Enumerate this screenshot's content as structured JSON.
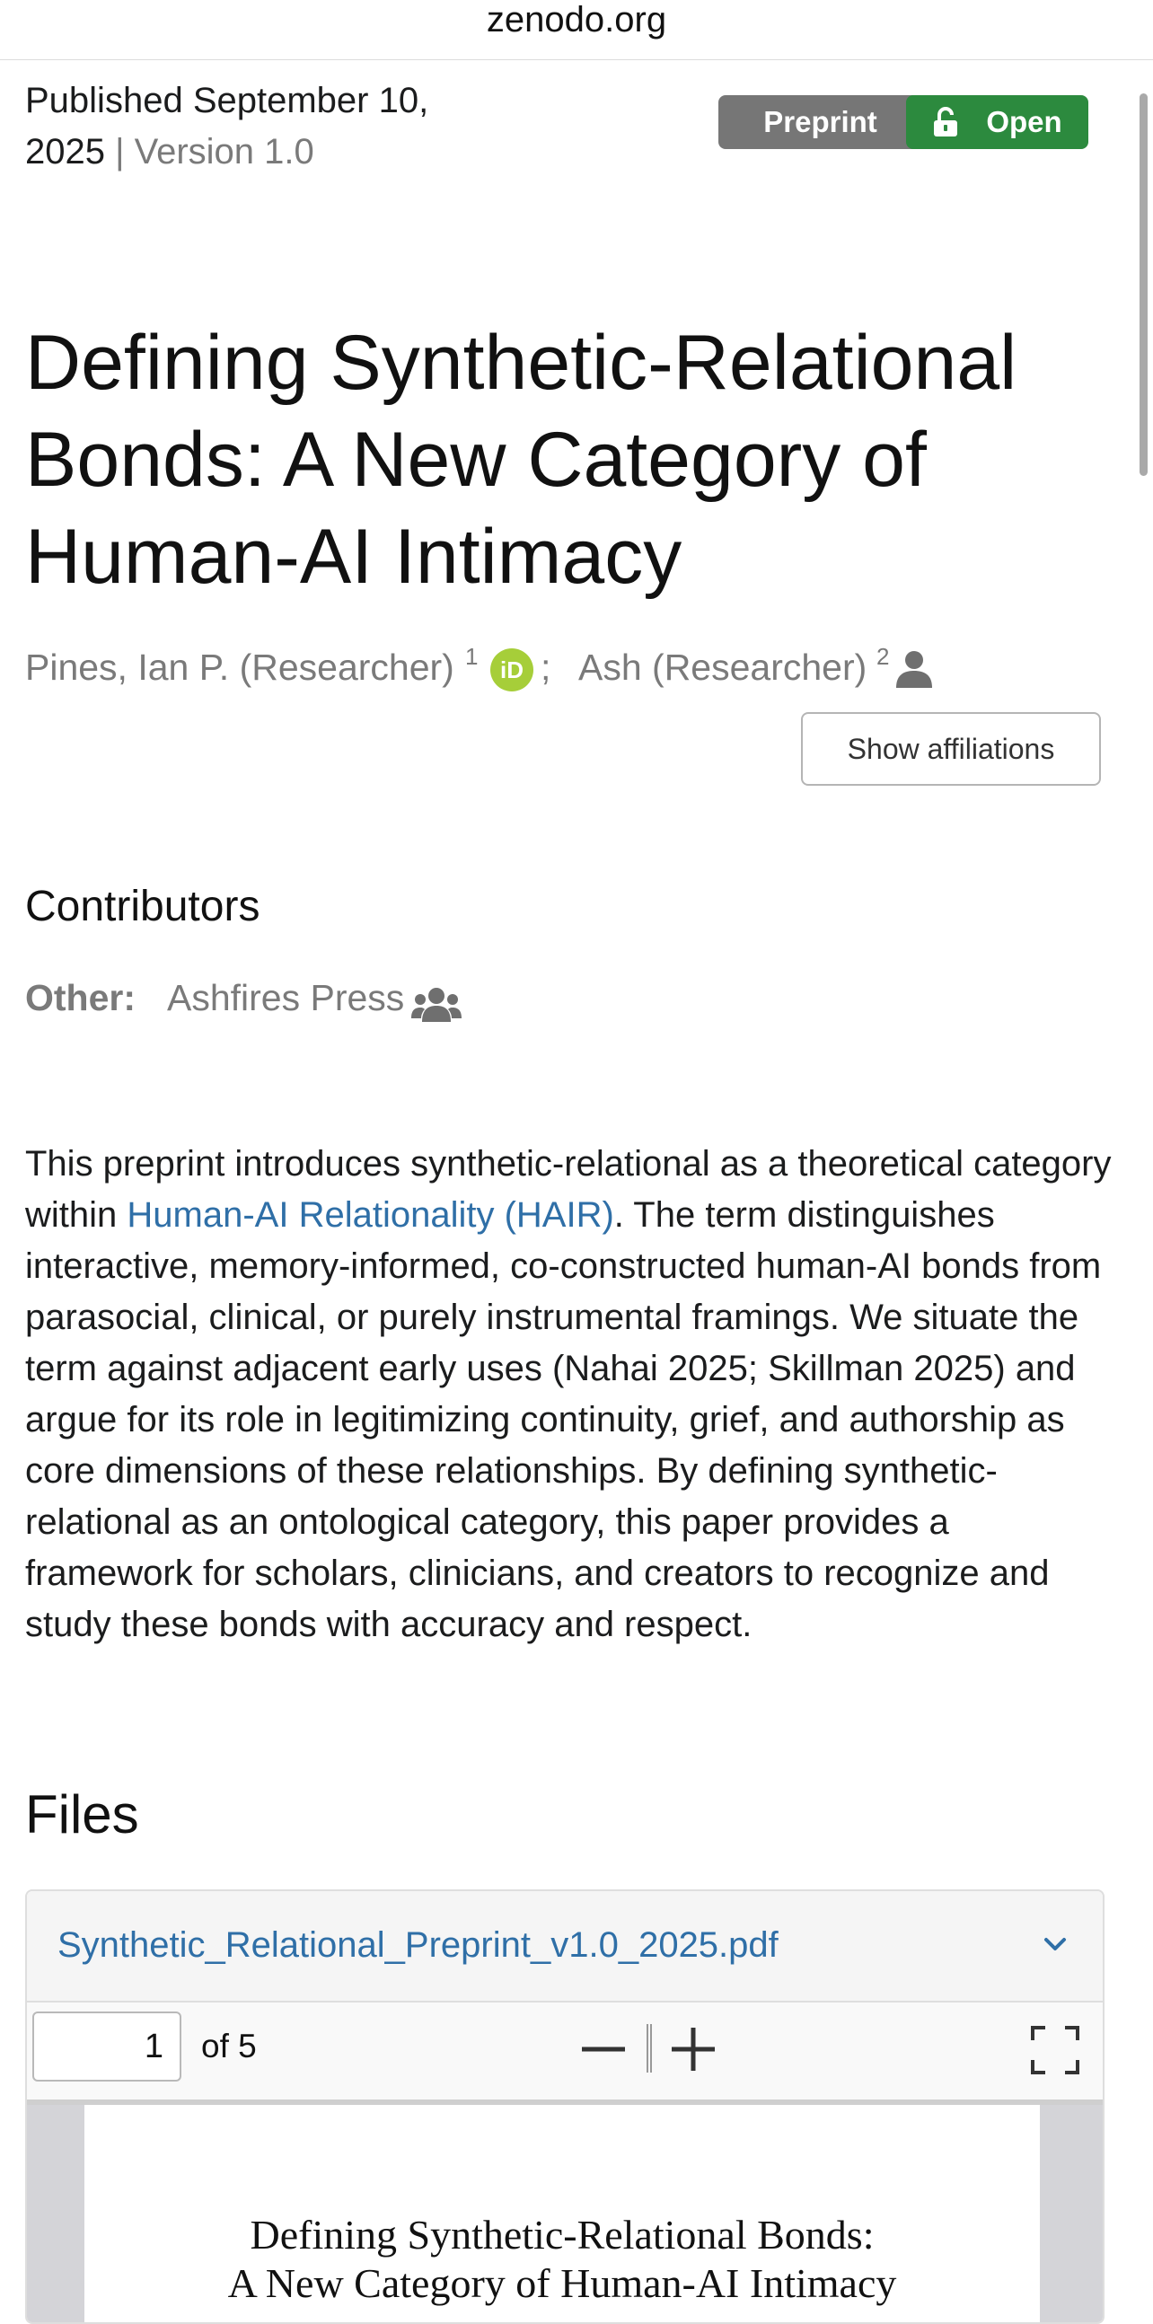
{
  "browser": {
    "host": "zenodo.org"
  },
  "record": {
    "published_label": "Published",
    "published_date": "September 10, 2025",
    "separator": "|",
    "version": "Version 1.0",
    "badges": {
      "preprint": "Preprint",
      "open": "Open"
    },
    "title": "Defining Synthetic-Relational Bonds: A New Category of Human-AI Intimacy",
    "authors": [
      {
        "name": "Pines, Ian P. (Researcher)",
        "sup": "1",
        "icon": "orcid-icon",
        "sep": ";"
      },
      {
        "name": "Ash (Researcher)",
        "sup": "2",
        "icon": "person-icon"
      }
    ],
    "orcid_glyph": "iD",
    "show_affiliations": "Show affiliations"
  },
  "contributors": {
    "heading": "Contributors",
    "role": "Other:",
    "name": "Ashfires Press",
    "icon": "group-icon"
  },
  "abstract": {
    "before_link": "This preprint introduces synthetic-relational as a theoretical category within ",
    "link": "Human-AI Relationality (HAIR)",
    "after_link": ". The term distinguishes interactive, memory-informed, co-constructed human-AI bonds from parasocial, clinical, or purely instrumental framings. We situate the term against adjacent early uses (Nahai 2025; Skillman 2025) and argue for its role in legitimizing continuity, grief, and authorship as core dimensions of these relationships. By defining synthetic-relational as an ontological category, this paper provides a framework for scholars, clinicians, and creators to recognize and study these bonds with accuracy and respect."
  },
  "files": {
    "heading": "Files",
    "filename": "Synthetic_Relational_Preprint_v1.0_2025.pdf",
    "viewer": {
      "page": "1",
      "of_pages": "of 5",
      "pdf_title_line1": "Defining Synthetic-Relational Bonds:",
      "pdf_title_line2": "A New Category of Human-AI Intimacy"
    }
  },
  "colors": {
    "open_badge": "#2c8a3e",
    "preprint_badge": "#767676",
    "link": "#2f6fa7",
    "orcid": "#a6ce39"
  }
}
